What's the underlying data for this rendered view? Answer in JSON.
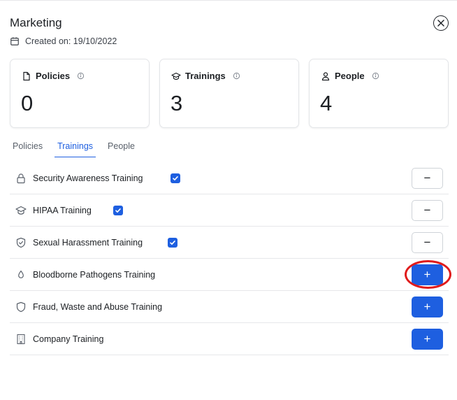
{
  "header": {
    "title": "Marketing",
    "created": "Created on: 19/10/2022"
  },
  "stats": [
    {
      "label": "Policies",
      "value": "0",
      "icon": "document-icon"
    },
    {
      "label": "Trainings",
      "value": "3",
      "icon": "graduation-cap-icon"
    },
    {
      "label": "People",
      "value": "4",
      "icon": "person-icon"
    }
  ],
  "tabs": [
    {
      "label": "Policies",
      "active": false
    },
    {
      "label": "Trainings",
      "active": true
    },
    {
      "label": "People",
      "active": false
    }
  ],
  "trainings": [
    {
      "name": "Security Awareness Training",
      "icon": "lock-icon",
      "assigned": true,
      "action": "−"
    },
    {
      "name": "HIPAA Training",
      "icon": "graduation-cap-icon",
      "assigned": true,
      "action": "−"
    },
    {
      "name": "Sexual Harassment Training",
      "icon": "shield-check-icon",
      "assigned": true,
      "action": "−"
    },
    {
      "name": "Bloodborne Pathogens Training",
      "icon": "droplet-icon",
      "assigned": false,
      "action": "+"
    },
    {
      "name": "Fraud, Waste and Abuse Training",
      "icon": "shield-icon",
      "assigned": false,
      "action": "+"
    },
    {
      "name": "Company Training",
      "icon": "building-icon",
      "assigned": false,
      "action": "+"
    }
  ],
  "colors": {
    "accent": "#1e5fe0",
    "highlight": "#e01b1b"
  }
}
